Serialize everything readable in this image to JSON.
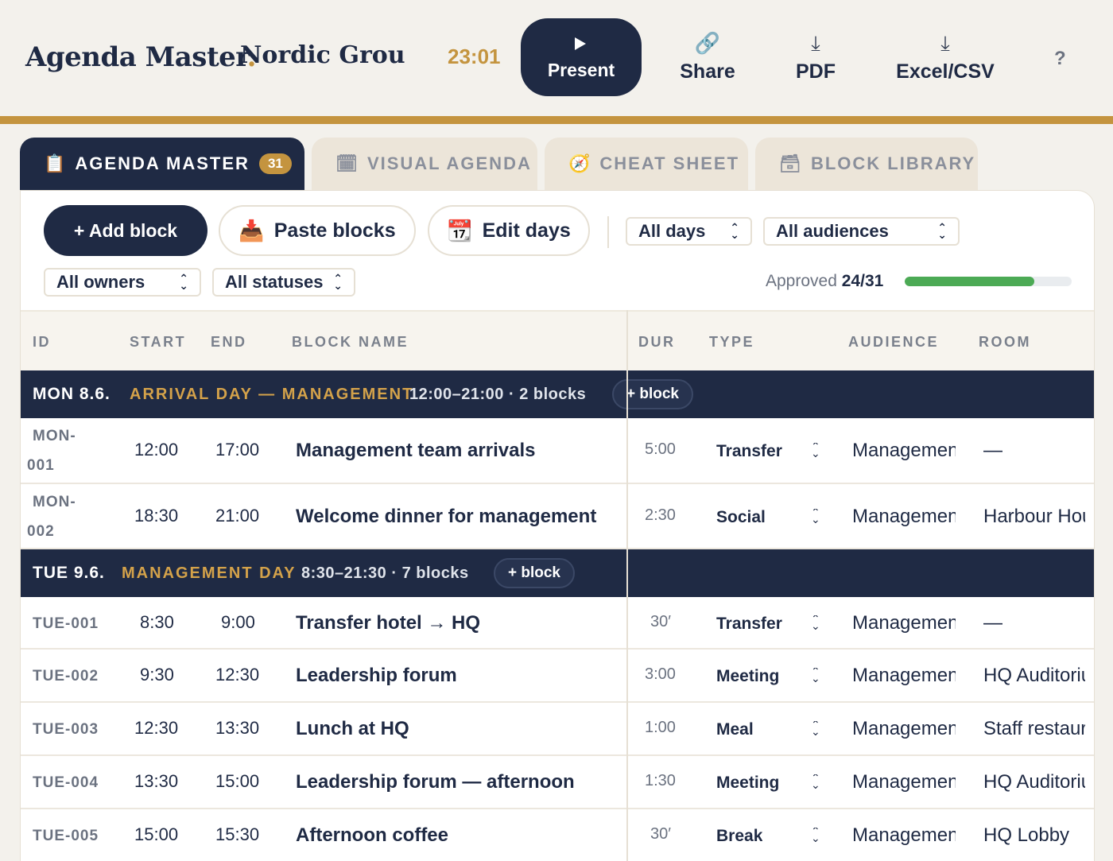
{
  "app": {
    "logo_text": "Agenda Master",
    "logo_dot": ".",
    "project_title": "Nordic Group (",
    "clock": "23:01",
    "present_label": "Present",
    "actions": [
      {
        "label": "Share",
        "icon": "link-icon"
      },
      {
        "label": "PDF",
        "icon": "download-icon"
      },
      {
        "label": "Excel/CSV",
        "icon": "download-icon"
      }
    ],
    "help_label": "?"
  },
  "tabs": [
    {
      "label": "AGENDA MASTER",
      "icon": "clipboard-icon",
      "badge": "31",
      "active": true
    },
    {
      "label": "VISUAL AGENDA",
      "icon": "calendar-icon",
      "active": false
    },
    {
      "label": "CHEAT SHEET",
      "icon": "compass-icon",
      "active": false
    },
    {
      "label": "BLOCK LIBRARY",
      "icon": "package-icon",
      "active": false
    }
  ],
  "toolbar": {
    "add_block": "+ Add block",
    "paste_blocks": "Paste blocks",
    "edit_days": "Edit days",
    "filter_days": "All days",
    "filter_audiences": "All audiences",
    "filter_owners": "All owners",
    "filter_statuses": "All statuses",
    "approved_label": "Approved",
    "approved_value": "24/31",
    "approved_fraction": 0.774
  },
  "columns": {
    "id": "ID",
    "start": "START",
    "end": "END",
    "name": "BLOCK NAME",
    "dur": "DUR",
    "type": "TYPE",
    "audience": "AUDIENCE",
    "room": "ROOM"
  },
  "days": [
    {
      "label": "MON 8.6.",
      "name": "ARRIVAL DAY — MANAGEMENT",
      "meta": "12:00–21:00 · 2 blocks",
      "add": "+ block",
      "rows": [
        {
          "id_a": "MON-",
          "id_b": "001",
          "start": "12:00",
          "end": "17:00",
          "name": "Management team arrivals",
          "dur": "5:00",
          "type": "Transfer",
          "audience": "Management",
          "room": "—"
        },
        {
          "id_a": "MON-",
          "id_b": "002",
          "start": "18:30",
          "end": "21:00",
          "name": "Welcome dinner for management",
          "dur": "2:30",
          "type": "Social",
          "audience": "Management",
          "room": "Harbour House"
        }
      ]
    },
    {
      "label": "TUE 9.6.",
      "name": "MANAGEMENT DAY",
      "meta": "8:30–21:30 · 7 blocks",
      "add": "+ block",
      "rows": [
        {
          "id": "TUE-001",
          "start": "8:30",
          "end": "9:00",
          "name": "Transfer hotel → HQ",
          "dur": "30′",
          "type": "Transfer",
          "audience": "Management",
          "room": "—"
        },
        {
          "id": "TUE-002",
          "start": "9:30",
          "end": "12:30",
          "name": "Leadership forum",
          "dur": "3:00",
          "type": "Meeting",
          "audience": "Management",
          "room": "HQ Auditorium"
        },
        {
          "id": "TUE-003",
          "start": "12:30",
          "end": "13:30",
          "name": "Lunch at HQ",
          "dur": "1:00",
          "type": "Meal",
          "audience": "Management",
          "room": "Staff restaurant"
        },
        {
          "id": "TUE-004",
          "start": "13:30",
          "end": "15:00",
          "name": "Leadership forum — afternoon",
          "dur": "1:30",
          "type": "Meeting",
          "audience": "Management",
          "room": "HQ Auditorium"
        },
        {
          "id": "TUE-005",
          "start": "15:00",
          "end": "15:30",
          "name": "Afternoon coffee",
          "dur": "30′",
          "type": "Break",
          "audience": "Management",
          "room": "HQ Lobby"
        }
      ]
    }
  ],
  "colors": {
    "navy": "#1f2a44",
    "gold": "#c4943f",
    "green": "#4caa55"
  }
}
